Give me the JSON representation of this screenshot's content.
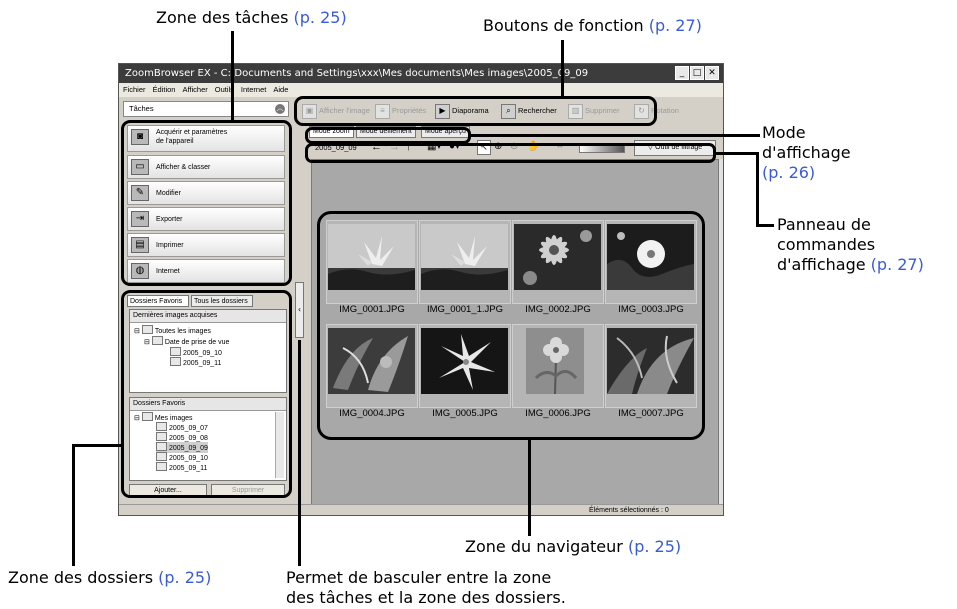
{
  "callouts": {
    "tasks_zone": {
      "text": "Zone des tâches",
      "ref": "(p. 25)"
    },
    "function_buttons": {
      "text": "Boutons de fonction",
      "ref": "(p. 27)"
    },
    "display_mode": {
      "line1": "Mode",
      "line2": "d'affichage",
      "ref": "(p. 26)"
    },
    "display_panel": {
      "line1": "Panneau de",
      "line2": "commandes",
      "line3": "d'affichage",
      "ref": "(p. 27)"
    },
    "browser_zone": {
      "text": "Zone du navigateur",
      "ref": "(p. 25)"
    },
    "folders_zone": {
      "text": "Zone des dossiers",
      "ref": "(p. 25)"
    },
    "toggle_note": {
      "line1": "Permet de basculer entre la zone",
      "line2": "des tâches et la zone des dossiers."
    }
  },
  "window": {
    "title": "ZoomBrowser EX  -  C:\\Documents and Settings\\xxx\\Mes documents\\Mes images\\2005_09_09",
    "menu": [
      "Fichier",
      "Édition",
      "Afficher",
      "Outils",
      "Internet",
      "Aide"
    ]
  },
  "tasks": {
    "header": "Tâches",
    "items": [
      {
        "line1": "Acquérir et paramètres",
        "line2": "de l'appareil",
        "icon": "camera-icon"
      },
      {
        "label": "Afficher & classer",
        "icon": "folder-icon"
      },
      {
        "label": "Modifier",
        "icon": "edit-icon"
      },
      {
        "label": "Exporter",
        "icon": "export-icon"
      },
      {
        "label": "Imprimer",
        "icon": "printer-icon"
      },
      {
        "label": "Internet",
        "icon": "globe-icon"
      }
    ]
  },
  "folders": {
    "tabs": [
      "Dossiers Favoris",
      "Tous les dossiers"
    ],
    "recent_header": "Dernières images acquises",
    "recent_tree": [
      "Toutes les images",
      "Date de prise de vue",
      "2005_09_10",
      "2005_09_11"
    ],
    "fav_header": "Dossiers Favoris",
    "fav_tree": [
      "Mes images",
      "2005_09_07",
      "2005_09_08",
      "2005_09_09",
      "2005_09_10",
      "2005_09_11"
    ],
    "add_button": "Ajouter...",
    "delete_button": "Supprimer"
  },
  "toolbar": {
    "view_image": "Afficher l'image",
    "properties": "Propriétés",
    "slideshow": "Diaporama",
    "search": "Rechercher",
    "delete": "Supprimer",
    "rotate": "Rotation"
  },
  "modes": [
    "Mode zoom",
    "Mode défilement",
    "Mode aperçu"
  ],
  "view_controls": {
    "folder": "2005_09_09",
    "filter_tool": "Outil de filtrage"
  },
  "thumbnails": [
    {
      "name": "IMG_0001.JPG",
      "type": "lily-blue-sky"
    },
    {
      "name": "IMG_0001_1.JPG",
      "type": "lily-blue-sky"
    },
    {
      "name": "IMG_0002.JPG",
      "type": "pink-daisy"
    },
    {
      "name": "IMG_0003.JPG",
      "type": "white-flower-dark"
    },
    {
      "name": "IMG_0004.JPG",
      "type": "leaves"
    },
    {
      "name": "IMG_0005.JPG",
      "type": "white-lily-dark"
    },
    {
      "name": "IMG_0006.JPG",
      "type": "light-flower"
    },
    {
      "name": "IMG_0007.JPG",
      "type": "leaves-dark"
    }
  ],
  "status": {
    "selected": "Éléments sélectionnés : 0"
  }
}
